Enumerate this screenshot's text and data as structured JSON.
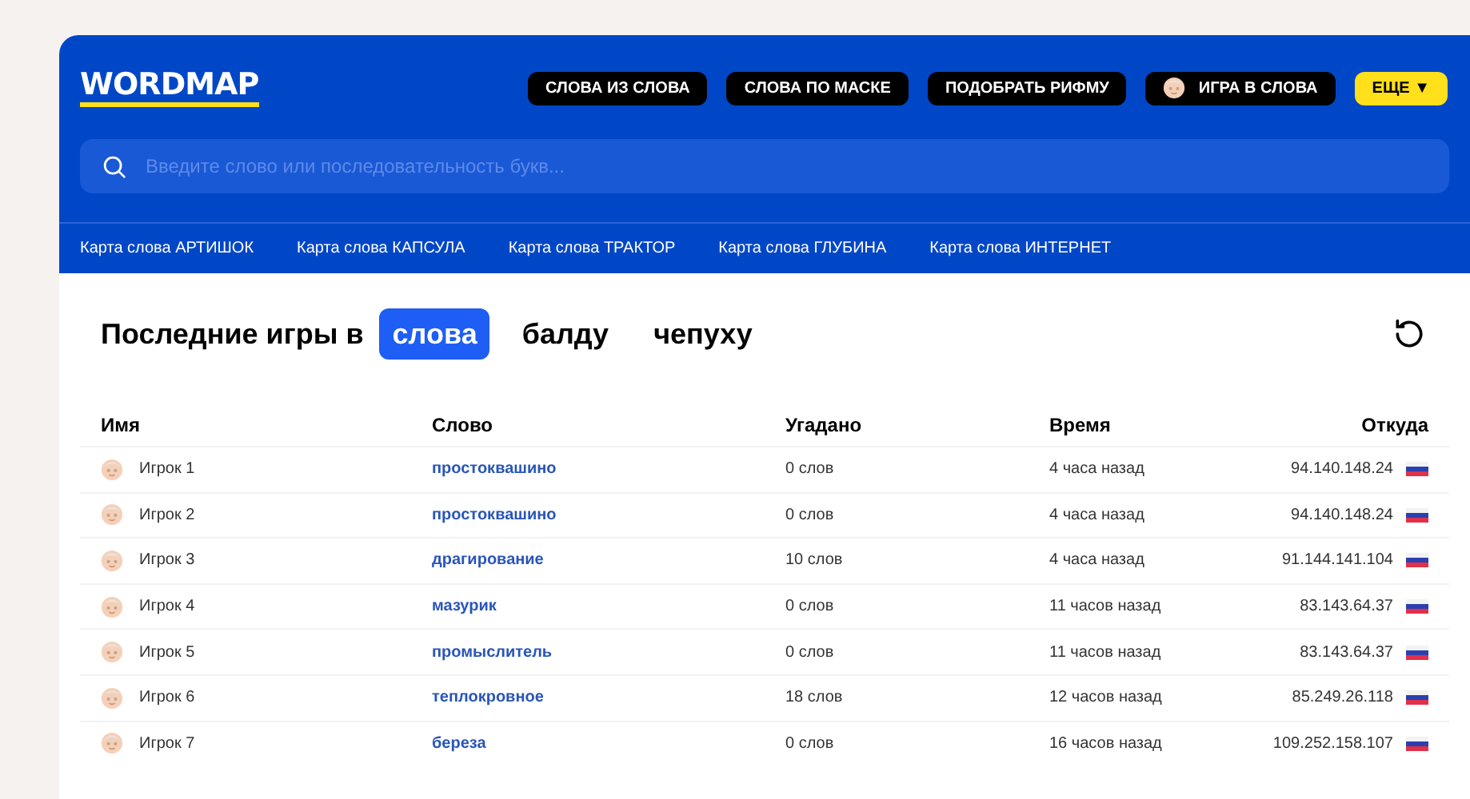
{
  "logo": "WORDMAP",
  "nav": [
    {
      "label": "СЛОВА ИЗ СЛОВА",
      "kind": "dark"
    },
    {
      "label": "СЛОВА ПО МАСКЕ",
      "kind": "dark"
    },
    {
      "label": "ПОДОБРАТЬ РИФМУ",
      "kind": "dark"
    },
    {
      "label": "ИГРА В СЛОВА",
      "kind": "avatar"
    },
    {
      "label": "ЕЩЕ ▼",
      "kind": "yellow"
    }
  ],
  "search": {
    "placeholder": "Введите слово или последовательность букв..."
  },
  "word_maps": [
    "Карта слова АРТИШОК",
    "Карта слова КАПСУЛА",
    "Карта слова ТРАКТОР",
    "Карта слова ГЛУБИНА",
    "Карта слова ИНТЕРНЕТ"
  ],
  "games": {
    "title": "Последние игры в",
    "tabs": [
      {
        "label": "слова",
        "selected": true
      },
      {
        "label": "балду",
        "selected": false
      },
      {
        "label": "чепуху",
        "selected": false
      }
    ]
  },
  "table": {
    "columns": [
      "Имя",
      "Слово",
      "Угадано",
      "Время",
      "Откуда"
    ],
    "rows": [
      {
        "name": "Игрок 1",
        "word": "простоквашино",
        "guessed": "0 слов",
        "time": "4 часа назад",
        "ip": "94.140.148.24"
      },
      {
        "name": "Игрок 2",
        "word": "простоквашино",
        "guessed": "0 слов",
        "time": "4 часа назад",
        "ip": "94.140.148.24"
      },
      {
        "name": "Игрок 3",
        "word": "драгирование",
        "guessed": "10 слов",
        "time": "4 часа назад",
        "ip": "91.144.141.104"
      },
      {
        "name": "Игрок 4",
        "word": "мазурик",
        "guessed": "0 слов",
        "time": "11 часов назад",
        "ip": "83.143.64.37"
      },
      {
        "name": "Игрок 5",
        "word": "промыслитель",
        "guessed": "0 слов",
        "time": "11 часов назад",
        "ip": "83.143.64.37"
      },
      {
        "name": "Игрок 6",
        "word": "теплокровное",
        "guessed": "18 слов",
        "time": "12 часов назад",
        "ip": "85.249.26.118"
      },
      {
        "name": "Игрок 7",
        "word": "береза",
        "guessed": "0 слов",
        "time": "16 часов назад",
        "ip": "109.252.158.107"
      }
    ]
  }
}
